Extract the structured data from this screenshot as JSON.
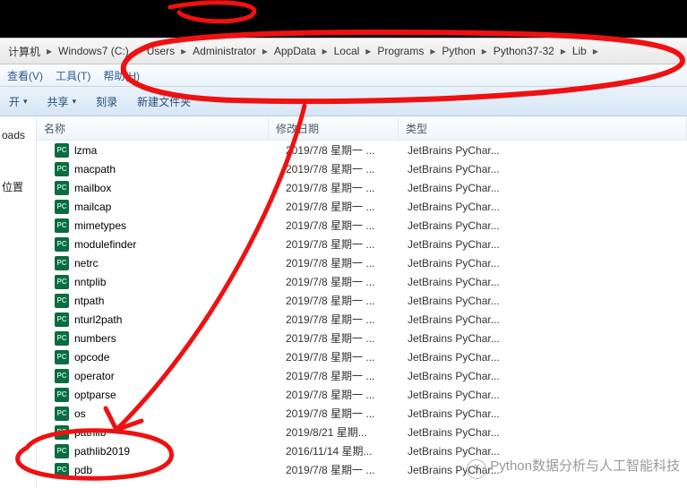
{
  "breadcrumb": [
    "计算机",
    "Windows7 (C:)",
    "Users",
    "Administrator",
    "AppData",
    "Local",
    "Programs",
    "Python",
    "Python37-32",
    "Lib"
  ],
  "menu": {
    "view": "查看(V)",
    "tools": "工具(T)",
    "help": "帮助(H)"
  },
  "toolbar": {
    "open": "开",
    "share": "共享",
    "burn": "刻录",
    "newfolder": "新建文件夹"
  },
  "sidebar": {
    "downloads": "oads",
    "locations": "位置"
  },
  "columns": {
    "name": "名称",
    "modified": "修改日期",
    "type": "类型"
  },
  "icon_label": "PC",
  "files": [
    {
      "name": "lzma",
      "date": "2019/7/8 星期一 ...",
      "type": "JetBrains PyChar..."
    },
    {
      "name": "macpath",
      "date": "2019/7/8 星期一 ...",
      "type": "JetBrains PyChar..."
    },
    {
      "name": "mailbox",
      "date": "2019/7/8 星期一 ...",
      "type": "JetBrains PyChar..."
    },
    {
      "name": "mailcap",
      "date": "2019/7/8 星期一 ...",
      "type": "JetBrains PyChar..."
    },
    {
      "name": "mimetypes",
      "date": "2019/7/8 星期一 ...",
      "type": "JetBrains PyChar..."
    },
    {
      "name": "modulefinder",
      "date": "2019/7/8 星期一 ...",
      "type": "JetBrains PyChar..."
    },
    {
      "name": "netrc",
      "date": "2019/7/8 星期一 ...",
      "type": "JetBrains PyChar..."
    },
    {
      "name": "nntplib",
      "date": "2019/7/8 星期一 ...",
      "type": "JetBrains PyChar..."
    },
    {
      "name": "ntpath",
      "date": "2019/7/8 星期一 ...",
      "type": "JetBrains PyChar..."
    },
    {
      "name": "nturl2path",
      "date": "2019/7/8 星期一 ...",
      "type": "JetBrains PyChar..."
    },
    {
      "name": "numbers",
      "date": "2019/7/8 星期一 ...",
      "type": "JetBrains PyChar..."
    },
    {
      "name": "opcode",
      "date": "2019/7/8 星期一 ...",
      "type": "JetBrains PyChar..."
    },
    {
      "name": "operator",
      "date": "2019/7/8 星期一 ...",
      "type": "JetBrains PyChar..."
    },
    {
      "name": "optparse",
      "date": "2019/7/8 星期一 ...",
      "type": "JetBrains PyChar..."
    },
    {
      "name": "os",
      "date": "2019/7/8 星期一 ...",
      "type": "JetBrains PyChar..."
    },
    {
      "name": "pathlib",
      "date": "2019/8/21 星期...",
      "type": "JetBrains PyChar..."
    },
    {
      "name": "pathlib2019",
      "date": "2016/11/14 星期...",
      "type": "JetBrains PyChar..."
    },
    {
      "name": "pdb",
      "date": "2019/7/8 星期一 ...",
      "type": "JetBrains PyChar..."
    }
  ],
  "watermark": "Python数据分析与人工智能科技",
  "watermark_icon": "✕"
}
